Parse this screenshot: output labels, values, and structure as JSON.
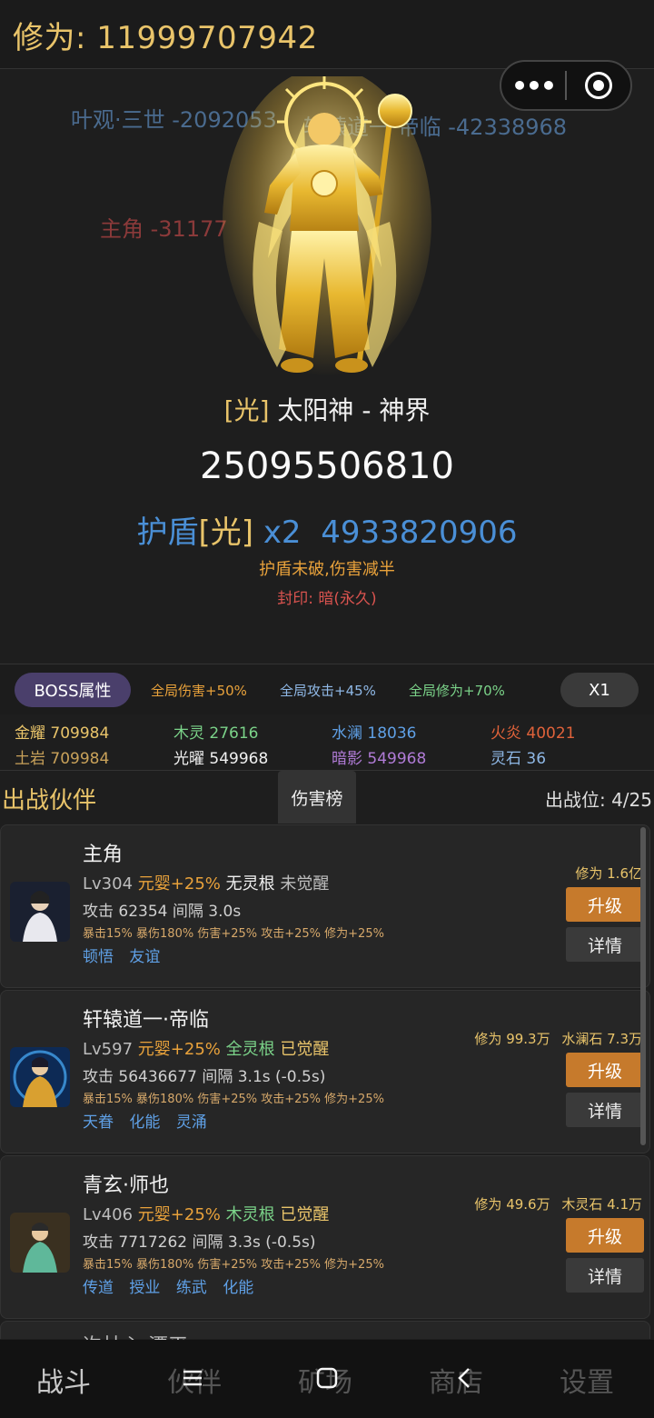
{
  "header": {
    "cultivation": "修为: 11999707942"
  },
  "damage_floats": [
    {
      "text": "叶观·三世 -2092053",
      "color": "#4a6b8f"
    },
    {
      "text": "轩辕道一·帝临 -42338968",
      "color": "#4a6b8f"
    },
    {
      "text": "主角 -31177",
      "color": "#8b3a3a"
    }
  ],
  "boss": {
    "element": "[光]",
    "name": "太阳神 - 神界",
    "hp": "25095506810",
    "shield_label": "护盾",
    "shield_element": "[光]",
    "shield_multiplier": "x2",
    "shield_value": "4933820906",
    "shield_note": "护盾未破,伤害减半",
    "seal_note": "封印: 暗(永久)"
  },
  "attr_bar": {
    "boss_attr_label": "BOSS属性",
    "buffs": [
      "全局伤害+50%",
      "全局攻击+45%",
      "全局修为+70%"
    ],
    "speed": "X1"
  },
  "resources": [
    {
      "label": "金耀 709984",
      "color": "#e9c46a"
    },
    {
      "label": "木灵 27616",
      "color": "#7bd389"
    },
    {
      "label": "水澜 18036",
      "color": "#5fa0e6"
    },
    {
      "label": "火炎 40021",
      "color": "#e0623a"
    },
    {
      "label": "土岩 709984",
      "color": "#c9a25a"
    },
    {
      "label": "光曜 549968",
      "color": "#f1f1f1"
    },
    {
      "label": "暗影 549968",
      "color": "#b07bd6"
    },
    {
      "label": "灵石 36",
      "color": "#8fb8e6"
    }
  ],
  "partners_section": {
    "title": "出战伙伴",
    "rank_tab": "伤害榜",
    "slots": "出战位: 4/25"
  },
  "partners": [
    {
      "name": "主角",
      "level": "Lv304",
      "stage": "元婴+25%",
      "root": "无灵根",
      "awaken": "未觉醒",
      "attack": "攻击 62354  间隔 3.0s",
      "bonuses": "暴击15% 暴伤180% 伤害+25% 攻击+25% 修为+25%",
      "tags": [
        "顿悟",
        "友谊"
      ],
      "cost": [
        "修为 1.6亿"
      ],
      "upgrade": "升级",
      "detail": "详情"
    },
    {
      "name": "轩辕道一·帝临",
      "level": "Lv597",
      "stage": "元婴+25%",
      "root": "全灵根",
      "awaken": "已觉醒",
      "attack": "攻击 56436677  间隔 3.1s (-0.5s)",
      "bonuses": "暴击15% 暴伤180% 伤害+25% 攻击+25% 修为+25%",
      "tags": [
        "天眷",
        "化能",
        "灵涌"
      ],
      "cost": [
        "修为 99.3万",
        "水澜石 7.3万"
      ],
      "upgrade": "升级",
      "detail": "详情"
    },
    {
      "name": "青玄·师也",
      "level": "Lv406",
      "stage": "元婴+25%",
      "root": "木灵根",
      "awaken": "已觉醒",
      "attack": "攻击 7717262  间隔 3.3s (-0.5s)",
      "bonuses": "暴击15% 暴伤180% 伤害+25% 攻击+25% 修为+25%",
      "tags": [
        "传道",
        "授业",
        "练武",
        "化能"
      ],
      "cost": [
        "修为 49.6万",
        "木灵石 4.1万"
      ],
      "upgrade": "升级",
      "detail": "详情"
    }
  ],
  "partial_partner_name": "许林心·潭平",
  "nav": {
    "tabs": [
      "战斗",
      "伙伴",
      "矿场",
      "商店",
      "设置"
    ],
    "system_icons": [
      "menu-icon",
      "home-icon",
      "back-icon"
    ]
  }
}
